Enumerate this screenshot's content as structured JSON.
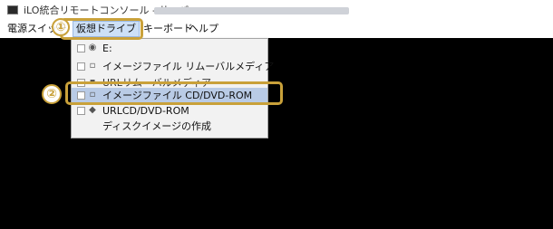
{
  "window": {
    "title": "iLO統合リモートコンソール - サーバー:",
    "icon": "ilo-app-icon"
  },
  "menubar": {
    "items": [
      {
        "label": "電源スイッチ"
      },
      {
        "label": "仮想ドライブ"
      },
      {
        "label": "キーボード"
      },
      {
        "label": "ヘルプ"
      }
    ]
  },
  "dropdown": {
    "items": [
      {
        "label": "E:",
        "icon": "drive-icon"
      },
      {
        "label": "イメージファイル リムーバルメディア",
        "icon": "file-icon"
      },
      {
        "label": "URLリムーバルメディア",
        "icon": "url-icon"
      },
      {
        "label": "イメージファイル CD/DVD-ROM",
        "icon": "file-icon"
      },
      {
        "label": "URLCD/DVD-ROM",
        "icon": "url-icon"
      },
      {
        "label": "ディスクイメージの作成",
        "icon": ""
      }
    ]
  },
  "annotations": {
    "step1": "①",
    "step2": "②"
  },
  "colors": {
    "highlight": "#c9a13a",
    "selected_row": "#b9cbe6",
    "console_bg": "#000000"
  }
}
